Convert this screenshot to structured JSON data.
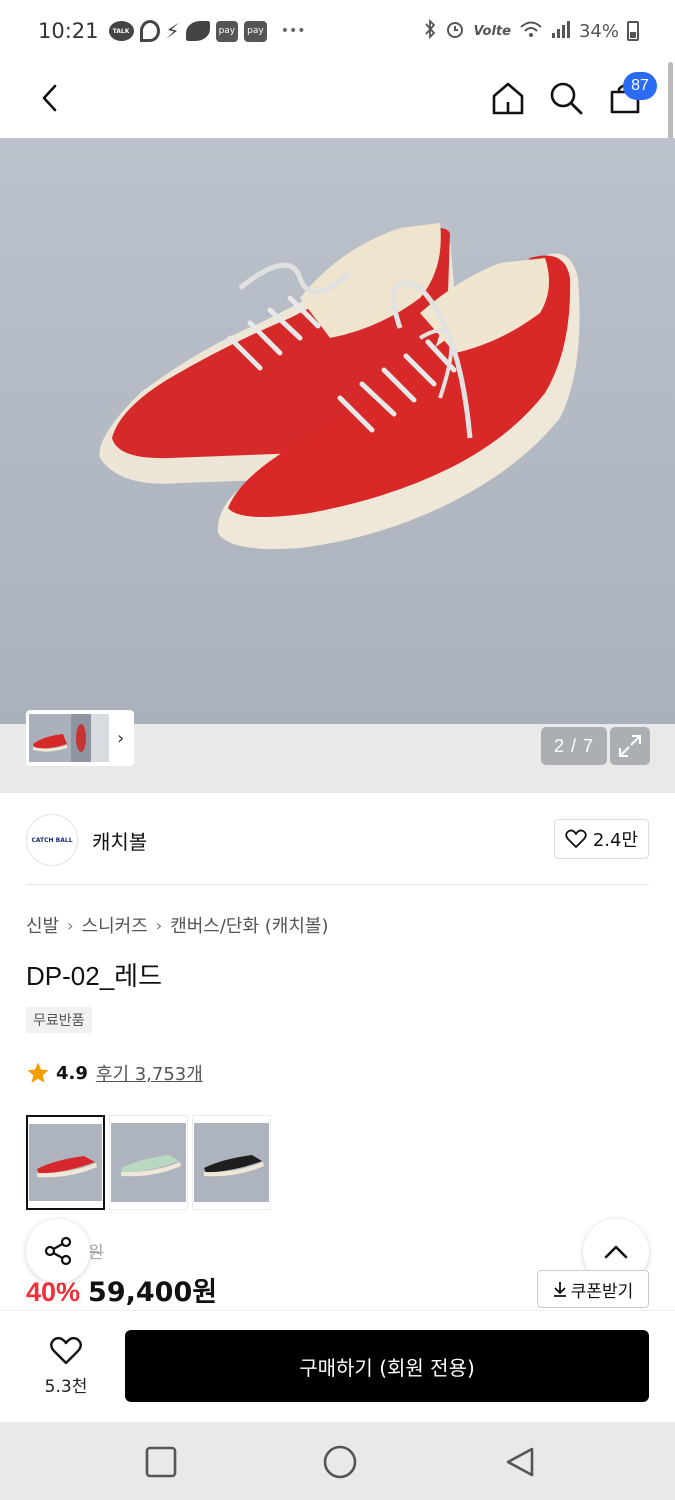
{
  "status_bar": {
    "time": "10:21",
    "notif_talk": "TALK",
    "pay1": "pay",
    "pay2": "pay",
    "overflow": "•••",
    "volte": "Volte",
    "battery": "34%"
  },
  "app_bar": {
    "cart_badge": "87"
  },
  "gallery": {
    "page_indicator": "2 / 7",
    "thumb_chevron": "›"
  },
  "brand": {
    "logo_text": "CATCH BALL",
    "name": "캐치볼",
    "likes": "2.4만"
  },
  "breadcrumb": [
    "신발",
    "스니커즈",
    "캔버스/단화 (캐치볼)"
  ],
  "product": {
    "title": "DP-02_레드",
    "tag": "무료반품",
    "rating": "4.9",
    "reviews": "후기 3,753개"
  },
  "variants": [
    {
      "color": "#d8272c"
    },
    {
      "color": "#b9d8c2"
    },
    {
      "color": "#1e1e1e"
    }
  ],
  "price": {
    "original_partial": "원",
    "discount": "40%",
    "sale": "59,400원"
  },
  "coupon_label": "쿠폰받기",
  "purchase_bar": {
    "wish_count": "5.3천",
    "buy_label": "구매하기 (회원 전용)"
  },
  "colors": {
    "accent_red": "#f0303a",
    "badge_blue": "#2b6bf3",
    "gallery_bg": "#b6bcc6"
  }
}
